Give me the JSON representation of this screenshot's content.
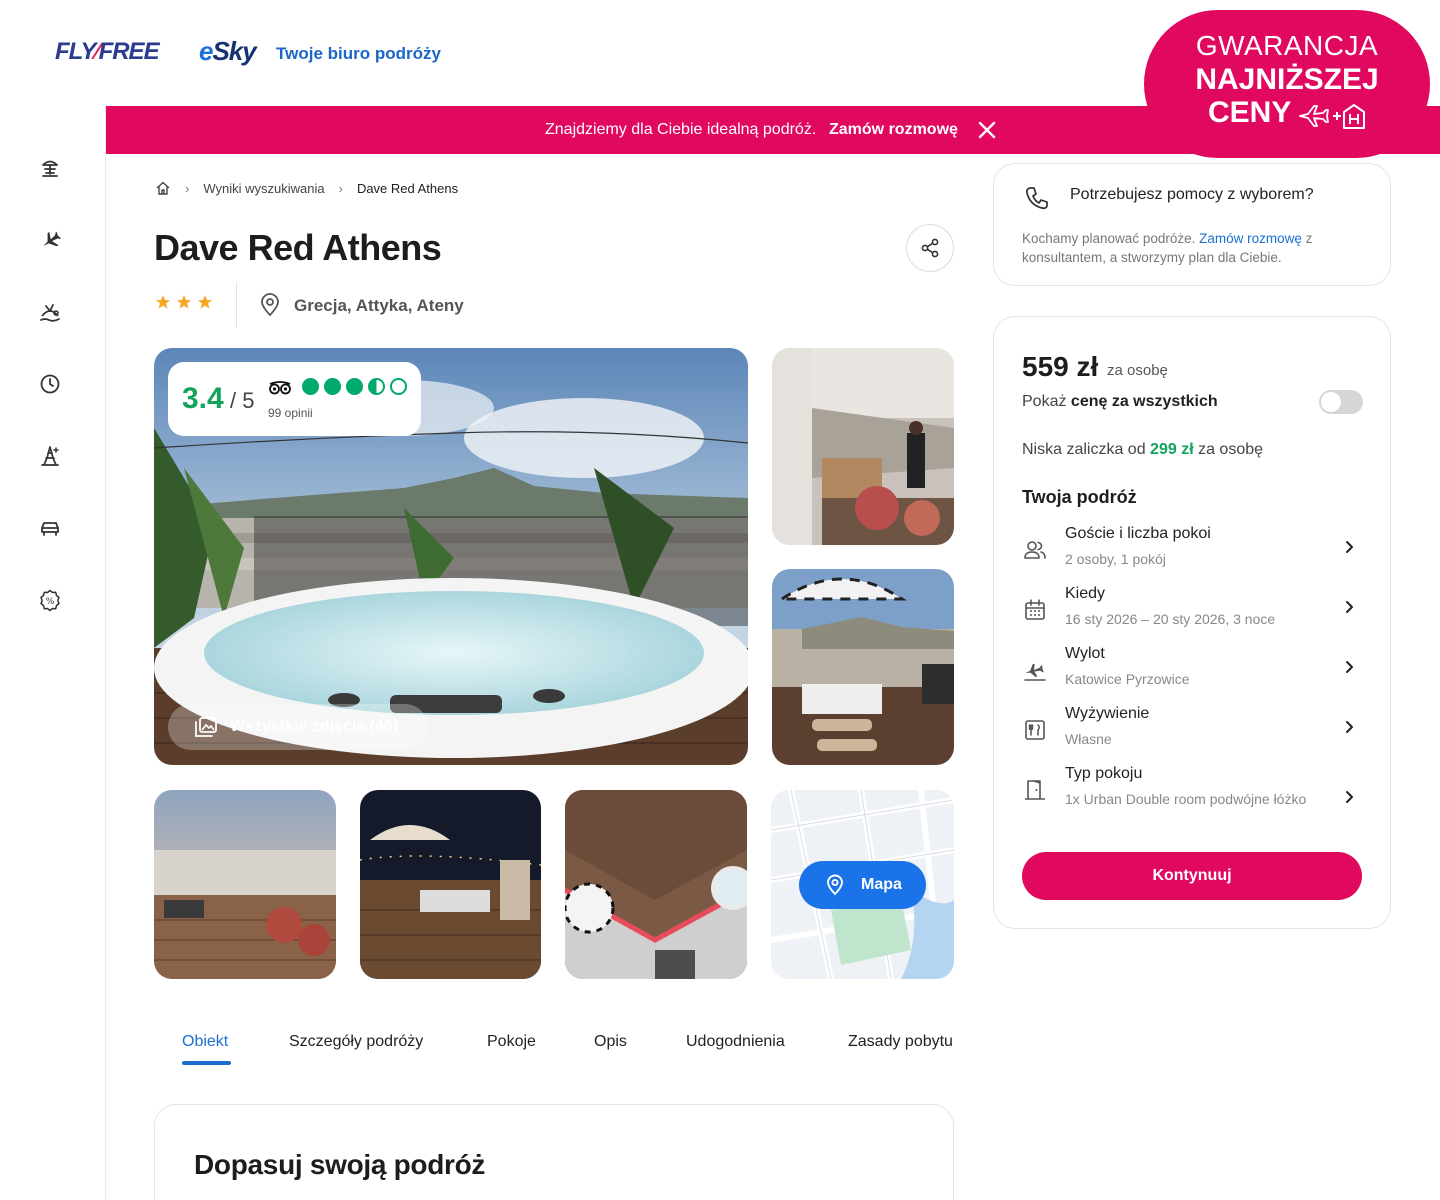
{
  "header": {
    "logo_flyfree_left": "FLY",
    "logo_flyfree_right": "FREE",
    "logo_esky": "Sky",
    "logo_esky_e": "e",
    "tagline": "Twoje biuro podróży"
  },
  "badge": {
    "line1": "GWARANCJA",
    "line2": "NAJNIŻSZEJ",
    "line3": "CENY",
    "plus": "+"
  },
  "promo": {
    "message": "Znajdziemy dla Ciebie idealną podróż.",
    "cta": "Zamów rozmowę"
  },
  "sidebar": {
    "icons": [
      "beach-umbrella-icon",
      "plane-icon",
      "island-icon",
      "clock-icon",
      "eiffel-tower-icon",
      "car-icon",
      "discount-icon"
    ]
  },
  "breadcrumb": {
    "home_icon": "home-icon",
    "items": [
      "Wyniki wyszukiwania",
      "Dave Red Athens"
    ],
    "separator": "›"
  },
  "hotel": {
    "name": "Dave Red Athens",
    "stars": 3,
    "location": "Grecja, Attyka, Ateny"
  },
  "rating": {
    "score": "3.4",
    "max": "/ 5",
    "reviews": "99 opinii",
    "dots": [
      "full",
      "full",
      "full",
      "half",
      "empty"
    ],
    "accent": "#00aa6c"
  },
  "gallery": {
    "all_photos": "Wszystkie zdjęcia (46)",
    "map_label": "Mapa"
  },
  "tabs": {
    "items": [
      "Obiekt",
      "Szczegóły podróży",
      "Pokoje",
      "Opis",
      "Udogodnienia",
      "Zasady pobytu"
    ],
    "active_index": 0
  },
  "section": {
    "title": "Dopasuj swoją podróż"
  },
  "help": {
    "question": "Potrzebujesz pomocy z wyborem?",
    "desc_before": "Kochamy planować podróże. ",
    "desc_link": "Zamów rozmowę",
    "desc_after": " z konsultantem, a stworzymy plan dla Ciebie."
  },
  "pricing": {
    "price": "559 zł",
    "unit": "za osobę",
    "show_all_prefix": "Pokaż ",
    "show_all_bold": "cenę za wszystkich",
    "toggle_on": false,
    "deposit_prefix": "Niska zaliczka od ",
    "deposit_amount": "299 zł",
    "deposit_suffix": " za osobę"
  },
  "trip": {
    "title": "Twoja podróż",
    "rows": [
      {
        "label": "Goście i liczba pokoi",
        "value": "2 osoby, 1 pokój",
        "icon": "guests-icon"
      },
      {
        "label": "Kiedy",
        "value": "16 sty 2026 – 20 sty 2026, 3 noce",
        "icon": "calendar-icon"
      },
      {
        "label": "Wylot",
        "value": "Katowice Pyrzowice",
        "icon": "departure-icon"
      },
      {
        "label": "Wyżywienie",
        "value": "Własne",
        "icon": "meal-icon"
      },
      {
        "label": "Typ pokoju",
        "value": "1x Urban Double room podwójne łóżko",
        "icon": "door-icon"
      }
    ],
    "continue": "Kontynuuj"
  },
  "colors": {
    "brand_pink": "#e0085f",
    "link_blue": "#1a6fd0",
    "green": "#12a35c"
  }
}
